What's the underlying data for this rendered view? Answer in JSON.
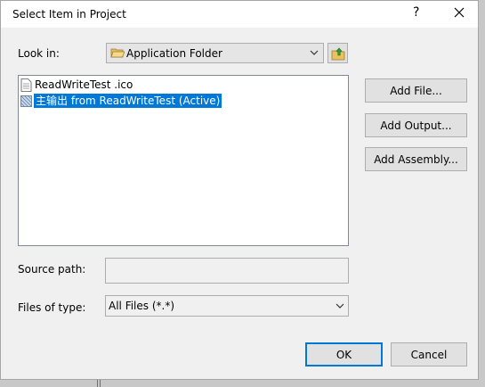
{
  "window": {
    "title": "Select Item in Project",
    "help_label": "?",
    "close_icon": "close-icon"
  },
  "look_in": {
    "label": "Look in:",
    "value": "Application Folder",
    "icon": "folder-open-icon",
    "up_icon": "folder-up-icon"
  },
  "file_list": {
    "items": [
      {
        "label": "ReadWriteTest .ico",
        "icon": "document-icon",
        "selected": false
      },
      {
        "label": "主输出 from ReadWriteTest (Active)",
        "icon": "primary-output-icon",
        "selected": true
      }
    ]
  },
  "buttons": {
    "add_file": "Add File...",
    "add_output": "Add Output...",
    "add_assembly": "Add Assembly...",
    "ok": "OK",
    "cancel": "Cancel"
  },
  "source_path": {
    "label": "Source path:",
    "value": ""
  },
  "files_of_type": {
    "label": "Files of type:",
    "value": "All Files (*.*)"
  },
  "colors": {
    "selection": "#0078d7",
    "dialog_bg": "#f0f0f0"
  }
}
